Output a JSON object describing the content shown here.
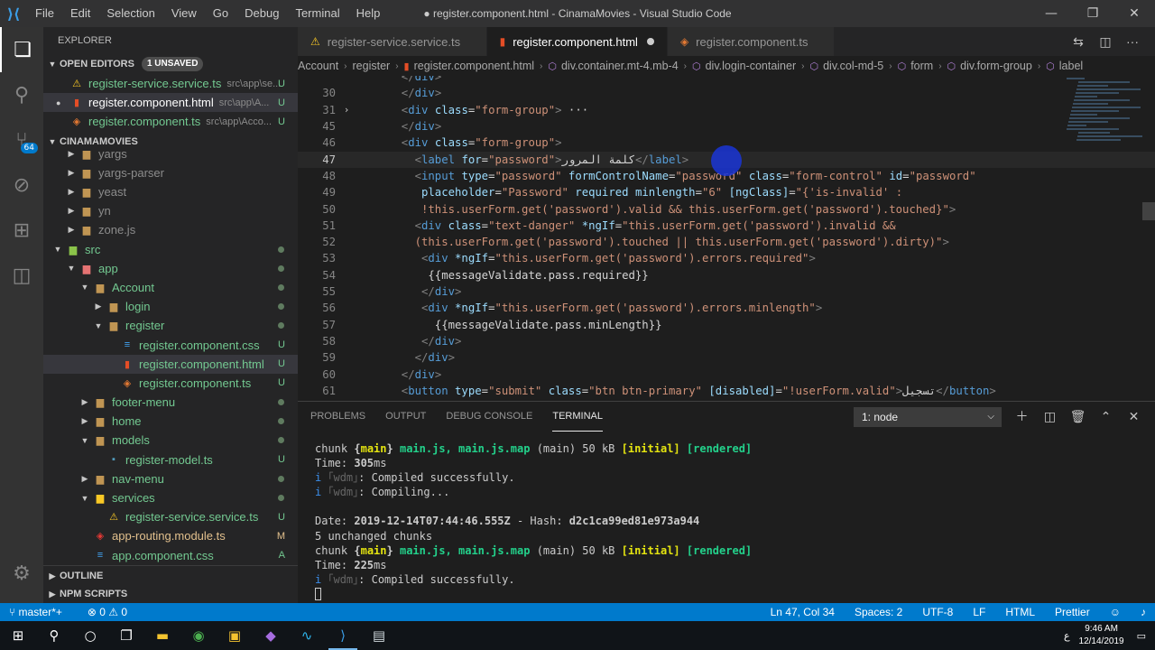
{
  "window": {
    "title": "● register.component.html - CinamaMovies - Visual Studio Code",
    "menu": [
      "File",
      "Edit",
      "Selection",
      "View",
      "Go",
      "Debug",
      "Terminal",
      "Help"
    ]
  },
  "activity": {
    "extensions_badge": "64"
  },
  "sidebar": {
    "header": "EXPLORER",
    "open_editors_label": "OPEN EDITORS",
    "unsaved_label": "1 UNSAVED",
    "open_editors": [
      {
        "name": "register-service.service.ts",
        "path": "src\\app\\se...",
        "status": "U",
        "icon": "warn"
      },
      {
        "name": "register.component.html",
        "path": "src\\app\\A...",
        "status": "U",
        "icon": "html",
        "modified": true,
        "selected": true
      },
      {
        "name": "register.component.ts",
        "path": "src\\app\\Acco...",
        "status": "U",
        "icon": "ng"
      }
    ],
    "project_label": "CINAMAMOVIES",
    "tree": [
      {
        "name": "yargs",
        "indent": 1,
        "type": "folder",
        "open": false
      },
      {
        "name": "yargs-parser",
        "indent": 1,
        "type": "folder",
        "open": false
      },
      {
        "name": "yeast",
        "indent": 1,
        "type": "folder",
        "open": false
      },
      {
        "name": "yn",
        "indent": 1,
        "type": "folder",
        "open": false
      },
      {
        "name": "zone.js",
        "indent": 1,
        "type": "folder",
        "open": false
      },
      {
        "name": "src",
        "indent": 0,
        "type": "foldersrc",
        "open": true,
        "dot": true
      },
      {
        "name": "app",
        "indent": 1,
        "type": "folderapp",
        "open": true,
        "dot": true
      },
      {
        "name": "Account",
        "indent": 2,
        "type": "folder",
        "open": true,
        "dot": true
      },
      {
        "name": "login",
        "indent": 3,
        "type": "folder",
        "open": false,
        "dot": true
      },
      {
        "name": "register",
        "indent": 3,
        "type": "folder",
        "open": true,
        "dot": true
      },
      {
        "name": "register.component.css",
        "indent": 4,
        "type": "css",
        "status": "U"
      },
      {
        "name": "register.component.html",
        "indent": 4,
        "type": "html",
        "status": "U",
        "selected": true
      },
      {
        "name": "register.component.ts",
        "indent": 4,
        "type": "ng",
        "status": "U"
      },
      {
        "name": "footer-menu",
        "indent": 2,
        "type": "folder",
        "open": false,
        "dot": true
      },
      {
        "name": "home",
        "indent": 2,
        "type": "folder",
        "open": false,
        "dot": true
      },
      {
        "name": "models",
        "indent": 2,
        "type": "folder",
        "open": true,
        "dot": true
      },
      {
        "name": "register-model.ts",
        "indent": 3,
        "type": "ts",
        "status": "U"
      },
      {
        "name": "nav-menu",
        "indent": 2,
        "type": "folder",
        "open": false,
        "dot": true
      },
      {
        "name": "services",
        "indent": 2,
        "type": "folderserv",
        "open": true,
        "dot": true
      },
      {
        "name": "register-service.service.ts",
        "indent": 3,
        "type": "warn",
        "status": "U"
      },
      {
        "name": "app-routing.module.ts",
        "indent": 2,
        "type": "red",
        "status": "M"
      },
      {
        "name": "app.component.css",
        "indent": 2,
        "type": "css",
        "status": "A"
      }
    ],
    "outline_label": "OUTLINE",
    "npm_label": "NPM SCRIPTS"
  },
  "tabs": [
    {
      "label": "register-service.service.ts",
      "icon": "warn"
    },
    {
      "label": "register.component.html",
      "icon": "html",
      "active": true,
      "modified": true
    },
    {
      "label": "register.component.ts",
      "icon": "ng"
    }
  ],
  "breadcrumb": [
    "Account",
    "register",
    "register.component.html",
    "div.container.mt-4.mb-4",
    "div.login-container",
    "div.col-md-5",
    "form",
    "div.form-group",
    "label"
  ],
  "editor": {
    "current_line": 47,
    "lines": [
      {
        "n": "",
        "html": "<span class='t'>&lt;/</span><span class='tg'>div</span><span class='t'>&gt;</span>",
        "indent": 12
      },
      {
        "n": "30",
        "html": "<span class='t'>&lt;/</span><span class='tg'>div</span><span class='t'>&gt;</span>",
        "indent": 12
      },
      {
        "n": "31",
        "fold": true,
        "html": "<span class='t'>&lt;</span><span class='tg'>div</span> <span class='at'>class</span>=<span class='sv'>\"form-group\"</span><span class='t'>&gt;</span><span class='tx'> ···</span>",
        "indent": 12
      },
      {
        "n": "45",
        "html": "<span class='t'>&lt;/</span><span class='tg'>div</span><span class='t'>&gt;</span>",
        "indent": 12
      },
      {
        "n": "46",
        "html": "<span class='t'>&lt;</span><span class='tg'>div</span> <span class='at'>class</span>=<span class='sv'>\"form-group\"</span><span class='t'>&gt;</span>",
        "indent": 12
      },
      {
        "n": "47",
        "html": "<span class='t'>&lt;</span><span class='tg'>label</span> <span class='at'>for</span>=<span class='sv'>\"password\"</span><span class='t'>&gt;</span><span class='tx'>كلمة المرور</span><span class='t'>&lt;/</span><span class='tg'>label</span><span class='t'>&gt;</span>",
        "indent": 14
      },
      {
        "n": "48",
        "html": "<span class='t'>&lt;</span><span class='tg'>input</span> <span class='at'>type</span>=<span class='sv'>\"password\"</span> <span class='at'>formControlName</span>=<span class='sv'>\"password\"</span> <span class='at'>class</span>=<span class='sv'>\"form-control\"</span> <span class='at'>id</span>=<span class='sv'>\"password\"</span>",
        "indent": 14
      },
      {
        "n": "49",
        "html": "<span class='at'>placeholder</span>=<span class='sv'>\"Password\"</span> <span class='at'>required</span> <span class='at'>minlength</span>=<span class='sv'>\"6\"</span> <span class='at'>[ngClass]</span>=<span class='sv'>\"{'is-invalid' :</span>",
        "indent": 15
      },
      {
        "n": "50",
        "html": "<span class='sv'>!this.userForm.get('password').valid &amp;&amp; this.userForm.get('password').touched}\"</span><span class='t'>&gt;</span>",
        "indent": 15
      },
      {
        "n": "51",
        "html": "<span class='t'>&lt;</span><span class='tg'>div</span> <span class='at'>class</span>=<span class='sv'>\"text-danger\"</span> <span class='at'>*ngIf</span>=<span class='sv'>\"this.userForm.get('password').invalid &amp;&amp;</span>",
        "indent": 14
      },
      {
        "n": "52",
        "html": "<span class='sv'>(this.userForm.get('password').touched || this.userForm.get('password').dirty)\"</span><span class='t'>&gt;</span>",
        "indent": 14
      },
      {
        "n": "53",
        "html": "<span class='t'>&lt;</span><span class='tg'>div</span> <span class='at'>*ngIf</span>=<span class='sv'>\"this.userForm.get('password').errors.required\"</span><span class='t'>&gt;</span>",
        "indent": 15
      },
      {
        "n": "54",
        "html": "<span class='tx'>{{messageValidate.pass.required}}</span>",
        "indent": 16
      },
      {
        "n": "55",
        "html": "<span class='t'>&lt;/</span><span class='tg'>div</span><span class='t'>&gt;</span>",
        "indent": 15
      },
      {
        "n": "56",
        "html": "<span class='t'>&lt;</span><span class='tg'>div</span> <span class='at'>*ngIf</span>=<span class='sv'>\"this.userForm.get('password').errors.minlength\"</span><span class='t'>&gt;</span>",
        "indent": 15
      },
      {
        "n": "57",
        "html": "<span class='tx'>{{messageValidate.pass.minLength}}</span>",
        "indent": 17
      },
      {
        "n": "58",
        "html": "<span class='t'>&lt;/</span><span class='tg'>div</span><span class='t'>&gt;</span>",
        "indent": 15
      },
      {
        "n": "59",
        "html": "<span class='t'>&lt;/</span><span class='tg'>div</span><span class='t'>&gt;</span>",
        "indent": 14
      },
      {
        "n": "60",
        "html": "<span class='t'>&lt;/</span><span class='tg'>div</span><span class='t'>&gt;</span>",
        "indent": 12
      },
      {
        "n": "61",
        "html": "<span class='t'>&lt;</span><span class='tg'>button</span> <span class='at'>type</span>=<span class='sv'>\"submit\"</span> <span class='at'>class</span>=<span class='sv'>\"btn btn-primary\"</span> <span class='at'>[disabled]</span>=<span class='sv'>\"!userForm.valid\"</span><span class='t'>&gt;</span><span class='tx'>تسجيل</span><span class='t'>&lt;/</span><span class='tg'>button</span><span class='t'>&gt;</span>",
        "indent": 12
      }
    ]
  },
  "panel": {
    "tabs": [
      "PROBLEMS",
      "OUTPUT",
      "DEBUG CONSOLE",
      "TERMINAL"
    ],
    "active_tab": "TERMINAL",
    "terminal_select": "1: node",
    "terminal_lines": [
      "chunk <span class='tb'>{</span><span class='ty'>main</span><span class='tb'>}</span> <span class='tgr'>main.js, main.js.map</span> (main) 50 kB <span class='ty'>[initial]</span> <span class='tgr'>[rendered]</span>",
      "Time: <span class='tb'>305</span>ms",
      "<span class='tblu'>i</span> <span class='tgy'>｢wdm｣</span>: Compiled successfully.",
      "<span class='tblu'>i</span> <span class='tgy'>｢wdm｣</span>: Compiling...",
      "",
      "Date: <span class='tb'>2019-12-14T07:44:46.555Z</span> - Hash: <span class='tb'>d2c1ca99ed81e973a944</span>",
      "5 unchanged chunks",
      "chunk <span class='tb'>{</span><span class='ty'>main</span><span class='tb'>}</span> <span class='tgr'>main.js, main.js.map</span> (main) 50 kB <span class='ty'>[initial]</span> <span class='tgr'>[rendered]</span>",
      "Time: <span class='tb'>225</span>ms",
      "<span class='tblu'>i</span> <span class='tgy'>｢wdm｣</span>: Compiled successfully."
    ]
  },
  "statusbar": {
    "branch": "master*+",
    "errors": "⊗ 0 ⚠ 0",
    "position": "Ln 47, Col 34",
    "spaces": "Spaces: 2",
    "encoding": "UTF-8",
    "eol": "LF",
    "language": "HTML",
    "formatter": "Prettier"
  },
  "taskbar": {
    "time": "9:46 AM",
    "date": "12/14/2019",
    "lang": "ع"
  }
}
